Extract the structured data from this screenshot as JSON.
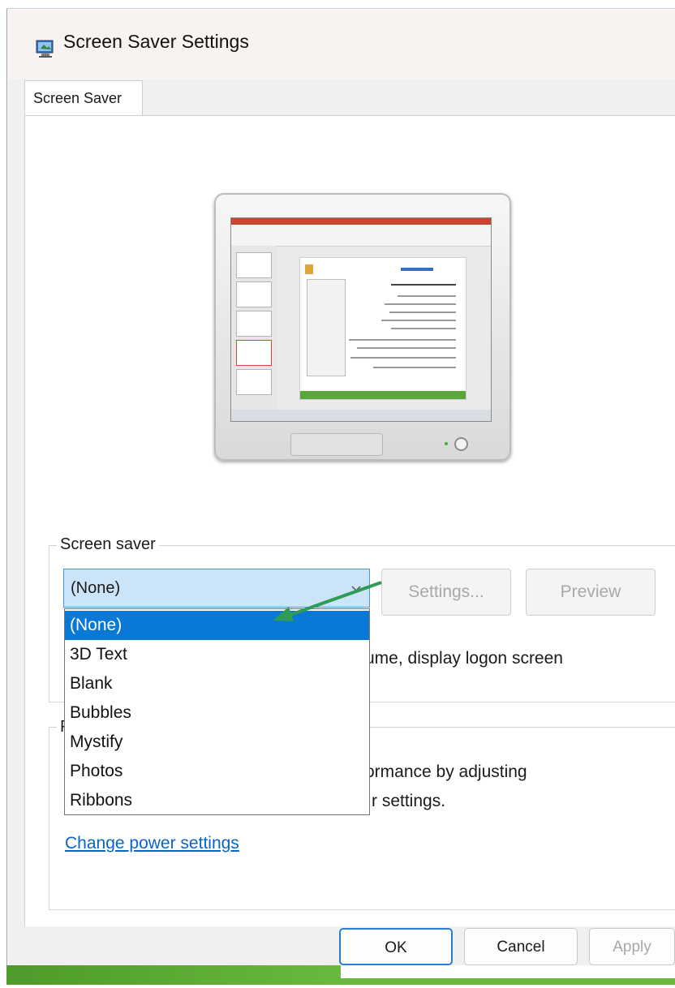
{
  "window": {
    "title": "Screen Saver Settings"
  },
  "tabs": [
    {
      "label": "Screen Saver"
    }
  ],
  "screen_saver_group": {
    "legend": "Screen saver",
    "selected_value": "(None)",
    "settings_button": "Settings...",
    "preview_button": "Preview",
    "resume_text_visible": "ume, display logon screen",
    "options": [
      "(None)",
      "3D Text",
      "Blank",
      "Bubbles",
      "Mystify",
      "Photos",
      "Ribbons"
    ],
    "highlighted_index": 0
  },
  "power_group": {
    "legend_visible": "P",
    "text_line1_visible": "ormance by adjusting",
    "text_line2_visible": "r settings.",
    "link": "Change power settings"
  },
  "footer": {
    "ok": "OK",
    "cancel": "Cancel",
    "apply": "Apply"
  },
  "colors": {
    "selection": "#0a78d7",
    "combo_background": "#cce4f7",
    "link": "#0a64c8",
    "arrow": "#2e9b57"
  },
  "icons": [
    "screen-saver-app-icon",
    "chevron-down-icon",
    "annotation-arrow"
  ]
}
